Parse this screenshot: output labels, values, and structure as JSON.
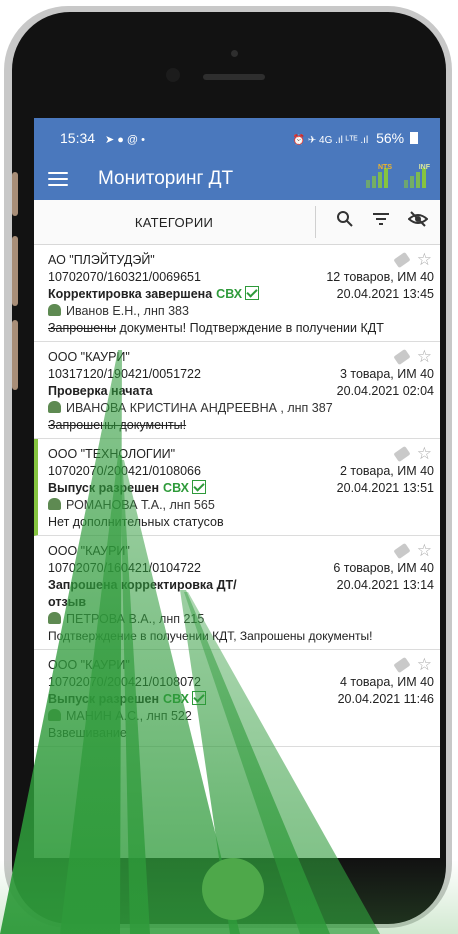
{
  "status_bar": {
    "time": "15:34",
    "left_icons": "➤ ● @ •",
    "right_icons": "⏰ ✈ 4G .ıl ᴸᵀᴱ .ıl",
    "battery": "56%"
  },
  "app_bar": {
    "title": "Мониторинг ДТ",
    "menu_icon": "hamburger-menu-icon",
    "icon_badges": [
      "NTS",
      "INF"
    ]
  },
  "toolbar": {
    "categories_label": "КАТЕГОРИИ",
    "icons": [
      "search-icon",
      "filter-icon",
      "hide-eye-icon"
    ]
  },
  "items": [
    {
      "company": "АО \"ПЛЭЙТУДЭЙ\"",
      "number": "10702070/160321/0069651",
      "goods": "12 товаров, ИМ 40",
      "status": "Корректировка завершена",
      "svh": "СВХ",
      "datetime": "20.04.2021 13:45",
      "person": "Иванов Е.Н., лнп 383",
      "note": "Запрошены документы! Подтверждение в получении КДТ",
      "note_strike": "Запрошены"
    },
    {
      "company": "ООО \"КАУРИ\"",
      "number": "10317120/190421/0051722",
      "goods": "3 товара, ИМ 40",
      "status": "Проверка начата",
      "svh": "",
      "datetime": "20.04.2021 02:04",
      "person": "ИВАНОВА КРИСТИНА АНДРЕЕВНА , лнп 387",
      "note": "Запрошены документы!",
      "note_strike": "Запрошены документы!"
    },
    {
      "company": "ООО \"ТЕХНОЛОГИИ\"",
      "number": "10702070/200421/0108066",
      "goods": "2 товара, ИМ 40",
      "status": "Выпуск разрешен",
      "svh": "СВХ",
      "datetime": "20.04.2021 13:51",
      "person": "РОМАНОВА Т.А., лнп 565",
      "note": "Нет дополнительных статусов",
      "note_strike": ""
    },
    {
      "company": "ООО \"КАУРИ\"",
      "number": "10702070/160421/0104722",
      "goods": "6 товаров, ИМ 40",
      "status": "Запрошена корректировка ДТ/ отзыв",
      "svh": "",
      "datetime": "20.04.2021 13:14",
      "person": "ПЕТРОВА В.А., лнп 215",
      "note": "Подтверждение в получении КДТ, Запрошены документы!",
      "note_strike": ""
    },
    {
      "company": "ООО \"КАУРИ\"",
      "number": "10702070/200421/0108072",
      "goods": "4 товара, ИМ 40",
      "status": "Выпуск разрешен",
      "svh": "СВХ",
      "datetime": "20.04.2021 11:46",
      "person": "МАНИН А.С., лнп 522",
      "note": "Взвешивание",
      "note_strike": ""
    }
  ],
  "colors": {
    "app_bar": "#4a78bd",
    "accent_green": "#86c440",
    "svh_green": "#2e9a3a",
    "home_button": "#4ea84a"
  }
}
